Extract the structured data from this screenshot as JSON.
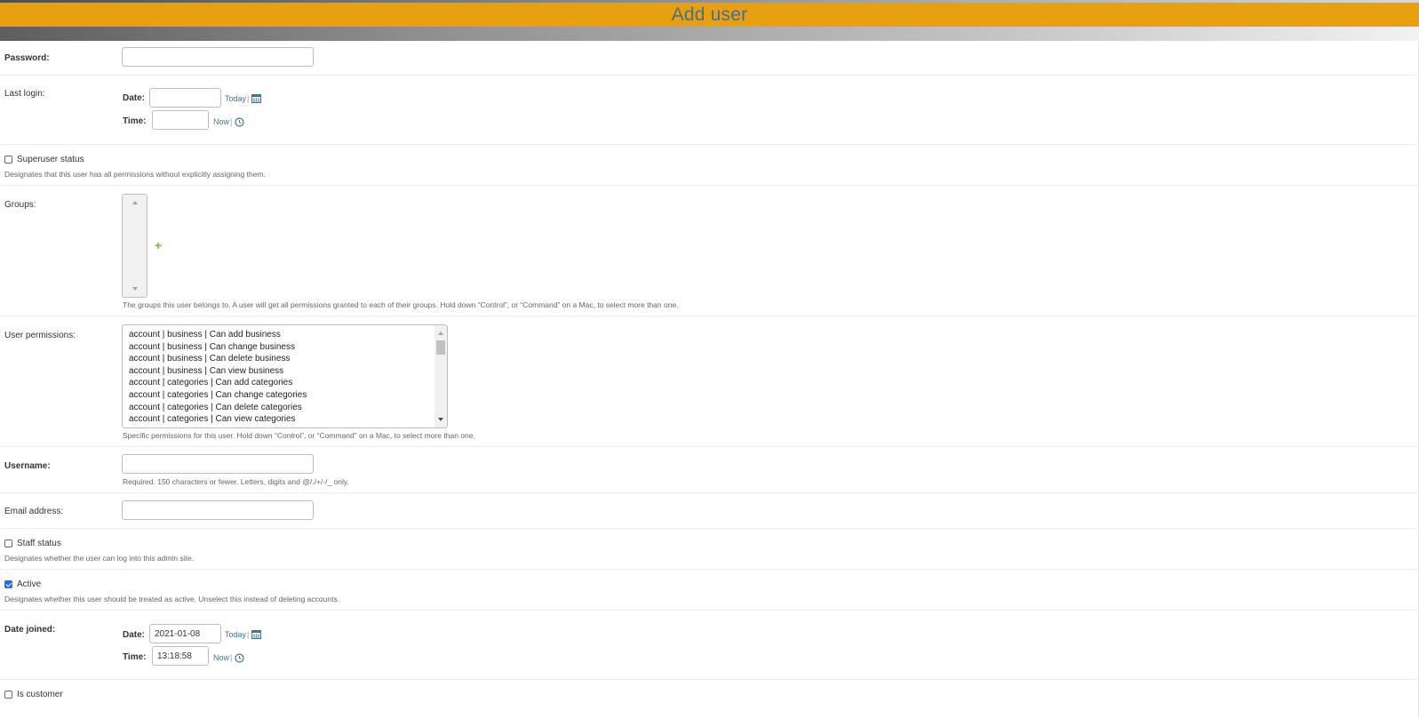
{
  "header": {
    "title": "Add user"
  },
  "password": {
    "label": "Password:"
  },
  "last_login": {
    "label": "Last login:",
    "date_label": "Date:",
    "date_value": "",
    "today_link": "Today",
    "sep": "|",
    "time_label": "Time:",
    "time_value": "",
    "now_link": "Now"
  },
  "superuser": {
    "label": "Superuser status",
    "checked": false,
    "help": "Designates that this user has all permissions without explicitly assigning them."
  },
  "groups": {
    "label": "Groups:",
    "help": "The groups this user belongs to. A user will get all permissions granted to each of their groups. Hold down “Control”, or “Command” on a Mac, to select more than one."
  },
  "user_permissions": {
    "label": "User permissions:",
    "options": [
      "account | business | Can add business",
      "account | business | Can change business",
      "account | business | Can delete business",
      "account | business | Can view business",
      "account | categories | Can add categories",
      "account | categories | Can change categories",
      "account | categories | Can delete categories",
      "account | categories | Can view categories"
    ],
    "help": "Specific permissions for this user. Hold down “Control”, or “Command” on a Mac, to select more than one."
  },
  "username": {
    "label": "Username:",
    "help": "Required. 150 characters or fewer. Letters, digits and @/./+/-/_ only."
  },
  "email": {
    "label": "Email address:"
  },
  "staff": {
    "label": "Staff status",
    "checked": false,
    "help": "Designates whether the user can log into this admin site."
  },
  "active": {
    "label": "Active",
    "checked": true,
    "help": "Designates whether this user should be treated as active. Unselect this instead of deleting accounts."
  },
  "date_joined": {
    "label": "Date joined:",
    "date_label": "Date:",
    "date_value": "2021-01-08",
    "today_link": "Today",
    "sep": "|",
    "time_label": "Time:",
    "time_value": "13:18:58",
    "now_link": "Now"
  },
  "is_customer": {
    "label": "Is customer",
    "checked": false
  },
  "icons": {
    "calendar": "calendar-icon",
    "clock": "clock-icon",
    "add": "plus-icon"
  },
  "colors": {
    "header_bg": "#e8a010",
    "title_color": "#4a6e8a",
    "link": "#417690",
    "add_green": "#70bf2b"
  }
}
